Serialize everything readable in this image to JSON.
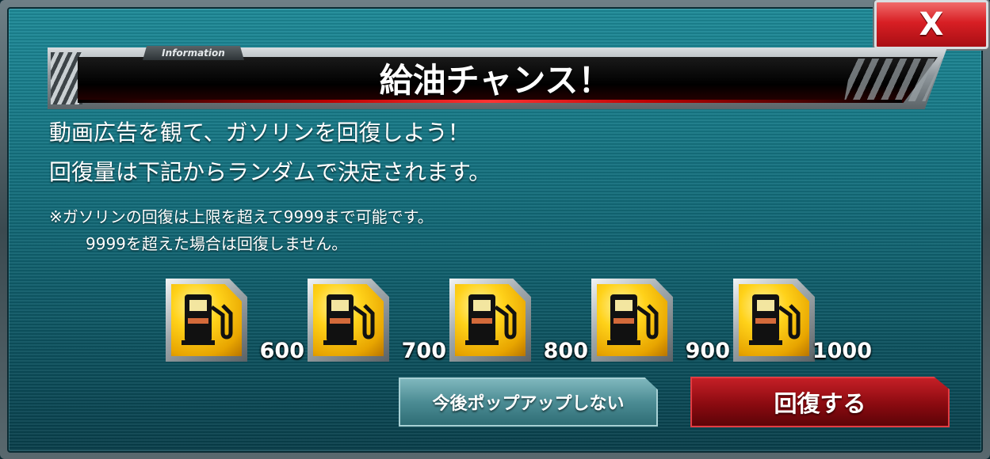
{
  "dialog": {
    "tag": "Information",
    "title": "給油チャンス！",
    "close_label": "X",
    "message_line1": "動画広告を観て、ガソリンを回復しよう！",
    "message_line2": "回復量は下記からランダムで決定されます。",
    "note_line1": "※ガソリンの回復は上限を超えて9999まで可能です。",
    "note_line2": "9999を超えた場合は回復しません。"
  },
  "fuel_options": [
    {
      "amount": "600"
    },
    {
      "amount": "700"
    },
    {
      "amount": "800"
    },
    {
      "amount": "900"
    },
    {
      "amount": "1000"
    }
  ],
  "buttons": {
    "skip_label": "今後ポップアップしない",
    "recover_label": "回復する"
  },
  "colors": {
    "panel": "#136e7c",
    "gold": "#ffd21a",
    "close_red": "#d81f24",
    "recover_red": "#8a0a10",
    "skip_teal": "#4c8c94"
  },
  "icons": {
    "fuel": "fuel-pump-icon",
    "close": "close-icon"
  }
}
